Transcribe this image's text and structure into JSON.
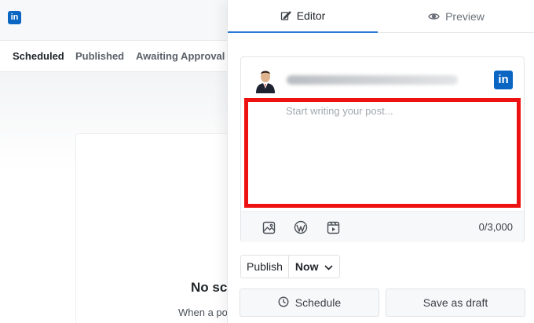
{
  "background": {
    "logo": "linkedin-icon",
    "tabs": [
      {
        "label": "Scheduled",
        "active": true
      },
      {
        "label": "Published",
        "active": false
      },
      {
        "label": "Awaiting Approval",
        "active": false
      }
    ],
    "empty_state": {
      "title": "No sc",
      "subtitle": "When a po"
    }
  },
  "panel": {
    "tabs": {
      "editor": {
        "label": "Editor",
        "icon": "edit-icon",
        "active": true
      },
      "preview": {
        "label": "Preview",
        "icon": "eye-icon",
        "active": false
      }
    },
    "composer": {
      "network_icon": "linkedin-icon",
      "placeholder": "Start writing your post...",
      "value": "",
      "counter": "0/3,000",
      "tools": [
        "image-icon",
        "wordpress-icon",
        "video-icon"
      ]
    },
    "publish": {
      "label": "Publish",
      "selected": "Now"
    },
    "buttons": {
      "schedule": "Schedule",
      "draft": "Save as draft"
    }
  },
  "colors": {
    "accent": "#2b7bd6",
    "linkedin": "#0a66c2",
    "highlight": "#ee1111"
  }
}
